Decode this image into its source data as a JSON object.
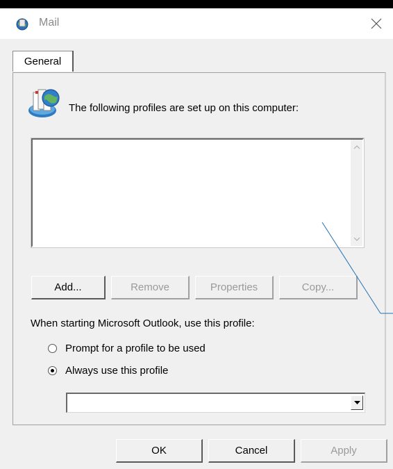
{
  "window": {
    "title": "Mail",
    "icon": "mail-globe-icon",
    "close_symbol": "✕"
  },
  "tabs": [
    {
      "label": "General",
      "selected": true
    }
  ],
  "general": {
    "intro_text": "The following profiles are set up on this computer:",
    "profiles": [],
    "buttons": {
      "add": "Add...",
      "remove": "Remove",
      "properties": "Properties",
      "copy": "Copy..."
    },
    "startup_label": "When starting Microsoft Outlook, use this profile:",
    "radio_prompt": "Prompt for a profile to be used",
    "radio_always": "Always use this profile",
    "selected_option": "always",
    "profile_dropdown_value": ""
  },
  "footer": {
    "ok": "OK",
    "cancel": "Cancel",
    "apply": "Apply"
  },
  "colors": {
    "window_bg": "#f0f0f0",
    "titlebar_bg": "#ffffff",
    "disabled_text": "#9a9a9a",
    "pointer_line": "#1f6fb3"
  }
}
